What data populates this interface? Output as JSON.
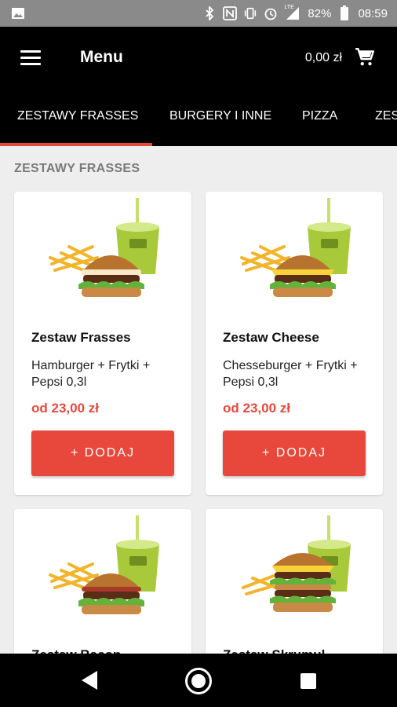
{
  "status_bar": {
    "battery": "82%",
    "time": "08:59",
    "network_label": "LTE",
    "icons": [
      "image-icon",
      "bluetooth-icon",
      "nfc-icon",
      "vibrate-icon",
      "alarm-icon",
      "signal-icon",
      "battery-icon"
    ]
  },
  "app_bar": {
    "title": "Menu",
    "cart_total": "0,00 zł"
  },
  "tabs": [
    {
      "label": "ZESTAWY FRASSES",
      "selected": true
    },
    {
      "label": "BURGERY I INNE",
      "selected": false
    },
    {
      "label": "PIZZA",
      "selected": false
    },
    {
      "label": "ZES",
      "selected": false
    }
  ],
  "section": {
    "title": "ZESTAWY FRASSES"
  },
  "products": [
    {
      "name": "Zestaw Frasses",
      "description": "Hamburger + Frytki + Pepsi 0,3l",
      "price": "od 23,00 zł",
      "button_label": "+ DODAJ"
    },
    {
      "name": "Zestaw Cheese",
      "description": "Chesseburger + Frytki + Pepsi 0,3l",
      "price": "od 23,00 zł",
      "button_label": "+ DODAJ"
    },
    {
      "name": "Zestaw Bacon",
      "description": "",
      "price": "",
      "button_label": ""
    },
    {
      "name": "Zestaw Skrumul",
      "description": "",
      "price": "",
      "button_label": ""
    }
  ],
  "colors": {
    "accent": "#e8483b",
    "app_bar": "#000000",
    "status_bar": "#8a8a8a",
    "background": "#eeeeee",
    "cup_green": "#a8c93a"
  }
}
